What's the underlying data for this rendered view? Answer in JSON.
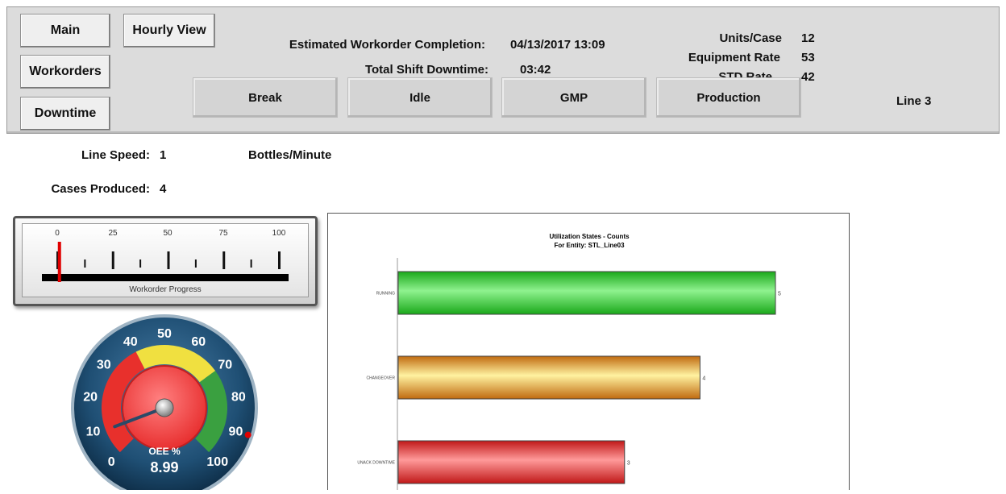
{
  "nav": {
    "main": "Main",
    "hourly_view": "Hourly View",
    "workorders": "Workorders",
    "downtime": "Downtime"
  },
  "info": {
    "est_completion_label": "Estimated Workorder Completion:",
    "est_completion_value": "04/13/2017  13:09",
    "shift_downtime_label": "Total Shift Downtime:",
    "shift_downtime_value": "03:42",
    "units_case_label": "Units/Case",
    "units_case_value": "12",
    "equipment_rate_label": "Equipment Rate",
    "equipment_rate_value": "53",
    "std_rate_label": "STD Rate",
    "std_rate_value": "42",
    "line_name": "Line 3"
  },
  "state_buttons": [
    "Break",
    "Idle",
    "GMP",
    "Production"
  ],
  "production": {
    "line_speed_label": "Line Speed:",
    "line_speed_value": "1",
    "line_speed_unit": "Bottles/Minute",
    "cases_label": "Cases Produced:",
    "cases_value": "4"
  },
  "progress_gauge": {
    "label": "Workorder Progress",
    "ticks": [
      "0",
      "25",
      "50",
      "75",
      "100"
    ],
    "value_percent": 1,
    "needle_color": "#e00000"
  },
  "oee_gauge": {
    "label": "OEE %",
    "value": "8.99",
    "value_num": 8.99,
    "ticks": [
      "0",
      "10",
      "20",
      "30",
      "40",
      "50",
      "60",
      "70",
      "80",
      "90",
      "100"
    ],
    "setpoint": 90,
    "zones": [
      {
        "from": 0,
        "to": 40,
        "color": "#e8302c"
      },
      {
        "from": 40,
        "to": 70,
        "color": "#f0e040"
      },
      {
        "from": 70,
        "to": 100,
        "color": "#3aa040"
      }
    ]
  },
  "chart_data": {
    "type": "bar",
    "orientation": "horizontal",
    "title": "Utilization States - Counts",
    "subtitle": "For Entity: STL_Line03",
    "categories": [
      "RUNNING",
      "CHANGEOVER",
      "UNACK DOWNTIME"
    ],
    "values": [
      5,
      4,
      3
    ],
    "colors": [
      "#2ecc2e",
      "#e0a040",
      "#e03030"
    ],
    "xlim": [
      0,
      5
    ]
  }
}
